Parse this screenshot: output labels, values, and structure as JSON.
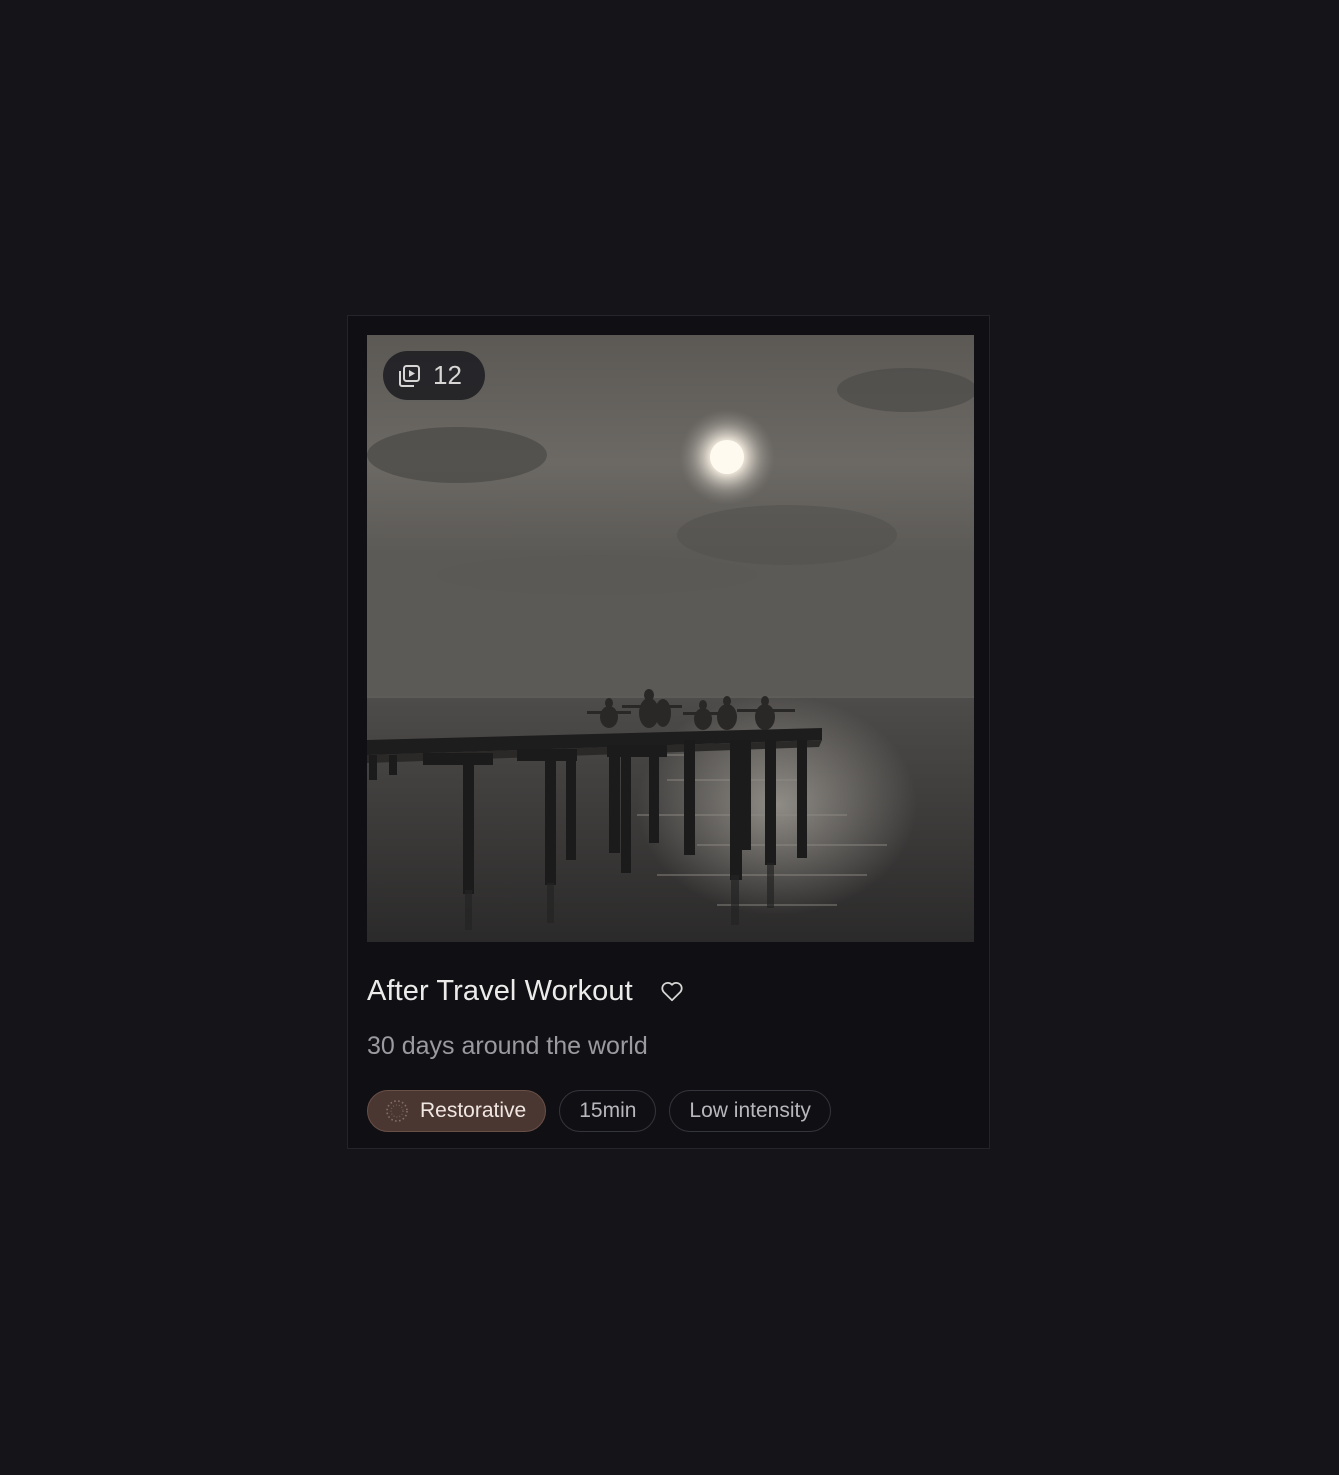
{
  "card": {
    "media": {
      "count": "12",
      "count_icon": "video-stack-icon"
    },
    "title": "After Travel Workout",
    "favorite_icon": "heart-outline-icon",
    "subtitle": "30 days around the world",
    "tags": [
      {
        "label": "Restorative",
        "icon": "dotted-circle-icon",
        "style": "primary"
      },
      {
        "label": "15min"
      },
      {
        "label": "Low intensity"
      }
    ]
  },
  "colors": {
    "background": "#141419",
    "card": "#101014",
    "primary_tag": "#4a3732"
  }
}
